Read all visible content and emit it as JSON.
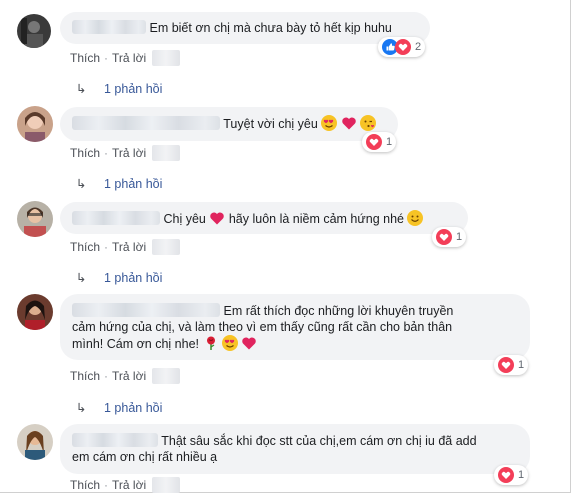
{
  "labels": {
    "like": "Thích",
    "reply": "Trả lời",
    "separator": "·",
    "arrow": "↳"
  },
  "comments": [
    {
      "text": "Em biết ơn chị mà chưa bày tỏ hết kịp huhu",
      "reaction_count": "2",
      "reply_count": "1 phản hồi"
    },
    {
      "text": "Tuyệt vời chị yêu",
      "reaction_count": "1",
      "reply_count": "1 phản hồi"
    },
    {
      "text_a": "Chị yêu",
      "text_b": "hãy luôn là niềm cảm hứng nhé",
      "reaction_count": "1",
      "reply_count": "1 phản hồi"
    },
    {
      "line1": "Em rất thích đọc những lời khuyên truyền",
      "line2": "cảm hứng của chị, và làm theo vì em thấy cũng rất cần cho bản thân",
      "line3": "mình! Cám ơn chị nhe!",
      "reaction_count": "1",
      "reply_count": "1 phản hồi"
    },
    {
      "line1": "Thật sâu sắc khi đọc stt của chị,em cám ơn chị iu đã add",
      "line2": "em cám ơn chị rất nhiều ạ",
      "reaction_count": "1"
    }
  ],
  "colors": {
    "bubble": "#f2f3f5",
    "link": "#385898",
    "love": "#f33e58",
    "like": "#1877f2"
  }
}
